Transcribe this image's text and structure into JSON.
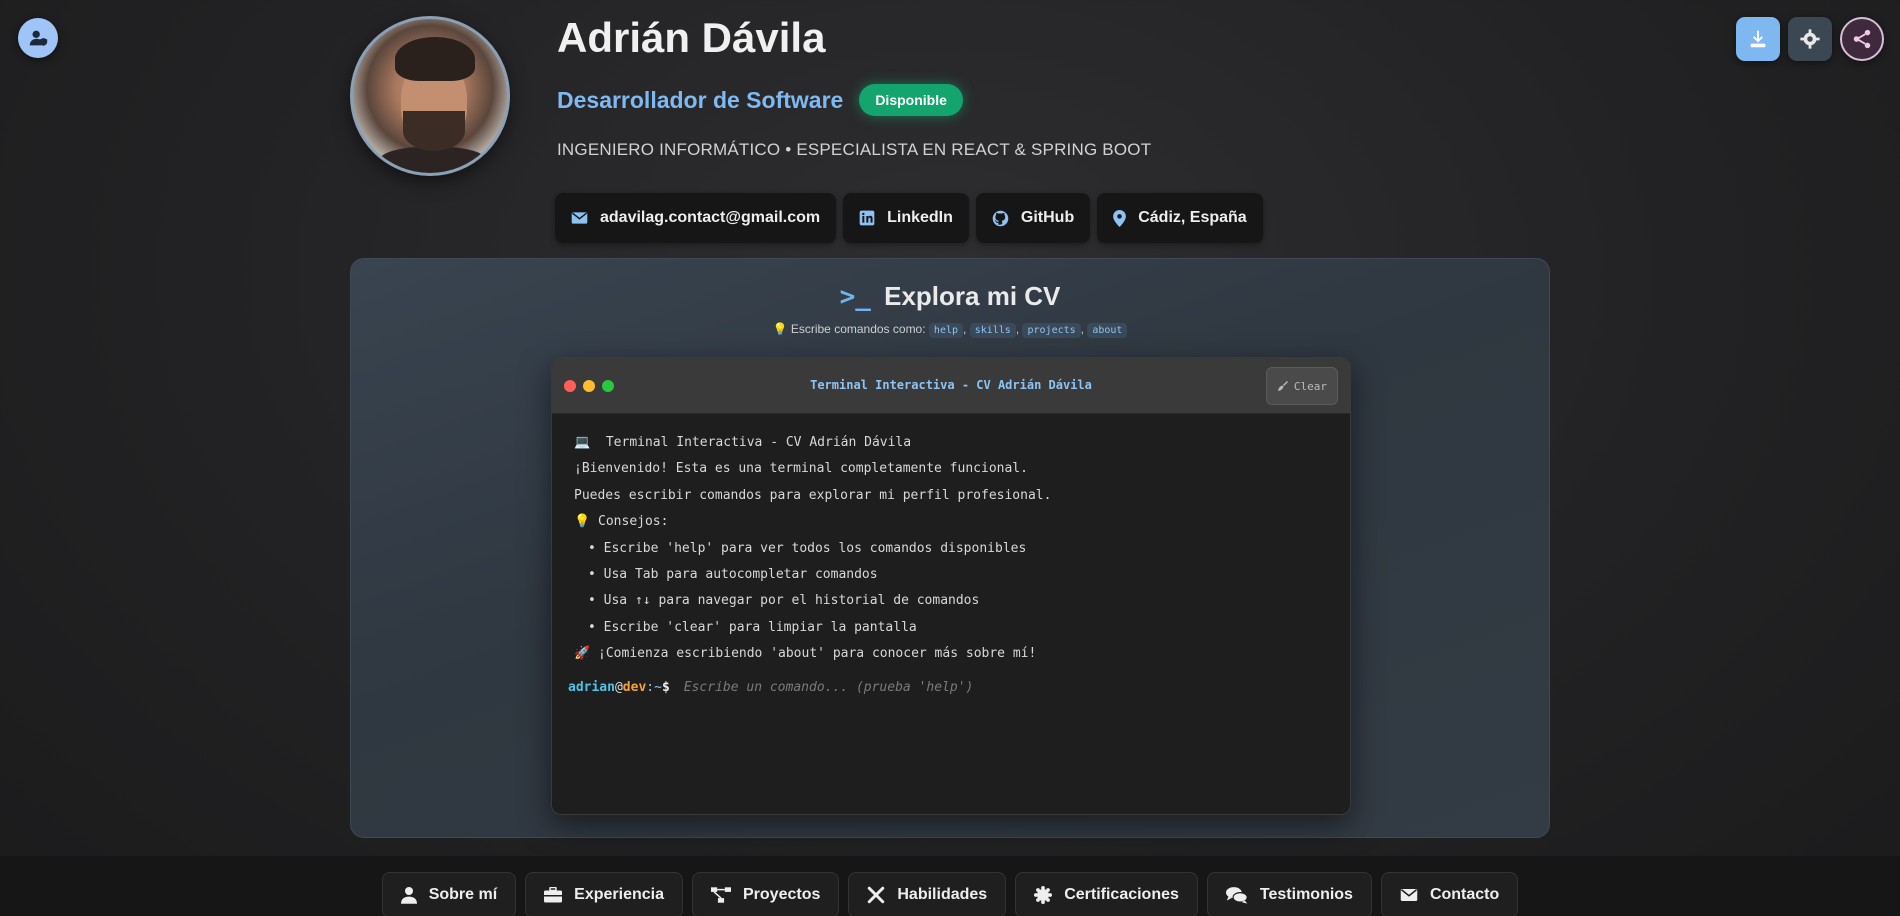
{
  "header": {
    "name": "Adrián Dávila",
    "role": "Desarrollador de Software",
    "status": "Disponible",
    "subtitle": "INGENIERO INFORMÁTICO • ESPECIALISTA EN REACT & SPRING BOOT"
  },
  "contacts": [
    {
      "label": "adavilag.contact@gmail.com",
      "icon": "envelope-icon"
    },
    {
      "label": "LinkedIn",
      "icon": "linkedin-icon"
    },
    {
      "label": "GitHub",
      "icon": "github-icon"
    },
    {
      "label": "Cádiz, España",
      "icon": "location-pin-icon"
    }
  ],
  "explore": {
    "title": "Explora mi CV",
    "hint_prefix": "Escribe comandos como:",
    "commands": [
      "help",
      "skills",
      "projects",
      "about"
    ]
  },
  "terminal": {
    "title": "Terminal Interactiva - CV Adrián Dávila",
    "clear_label": "Clear",
    "lines": [
      "💻  Terminal Interactiva - CV Adrián Dávila",
      "¡Bienvenido! Esta es una terminal completamente funcional.",
      "Puedes escribir comandos para explorar mi perfil profesional.",
      "💡 Consejos:",
      "• Escribe 'help' para ver todos los comandos disponibles",
      "• Usa Tab para autocompletar comandos",
      "• Usa ↑↓ para navegar por el historial de comandos",
      "• Escribe 'clear' para limpiar la pantalla",
      "🚀 ¡Comienza escribiendo 'about' para conocer más sobre mí!"
    ],
    "prompt": {
      "user": "adrian",
      "at": "@",
      "host": "dev",
      "path": ":~",
      "symbol": "$"
    },
    "input_placeholder": "Escribe un comando... (prueba 'help')"
  },
  "nav": [
    {
      "label": "Sobre mí",
      "icon": "user-icon"
    },
    {
      "label": "Experiencia",
      "icon": "briefcase-icon"
    },
    {
      "label": "Proyectos",
      "icon": "project-diagram-icon"
    },
    {
      "label": "Habilidades",
      "icon": "tools-icon"
    },
    {
      "label": "Certificaciones",
      "icon": "certificate-icon"
    },
    {
      "label": "Testimonios",
      "icon": "comments-icon"
    },
    {
      "label": "Contacto",
      "icon": "envelope-icon"
    }
  ],
  "colors": {
    "accent": "#7fb9f2",
    "status_green": "#13a56d",
    "terminal_bg": "#1e1e1e"
  }
}
